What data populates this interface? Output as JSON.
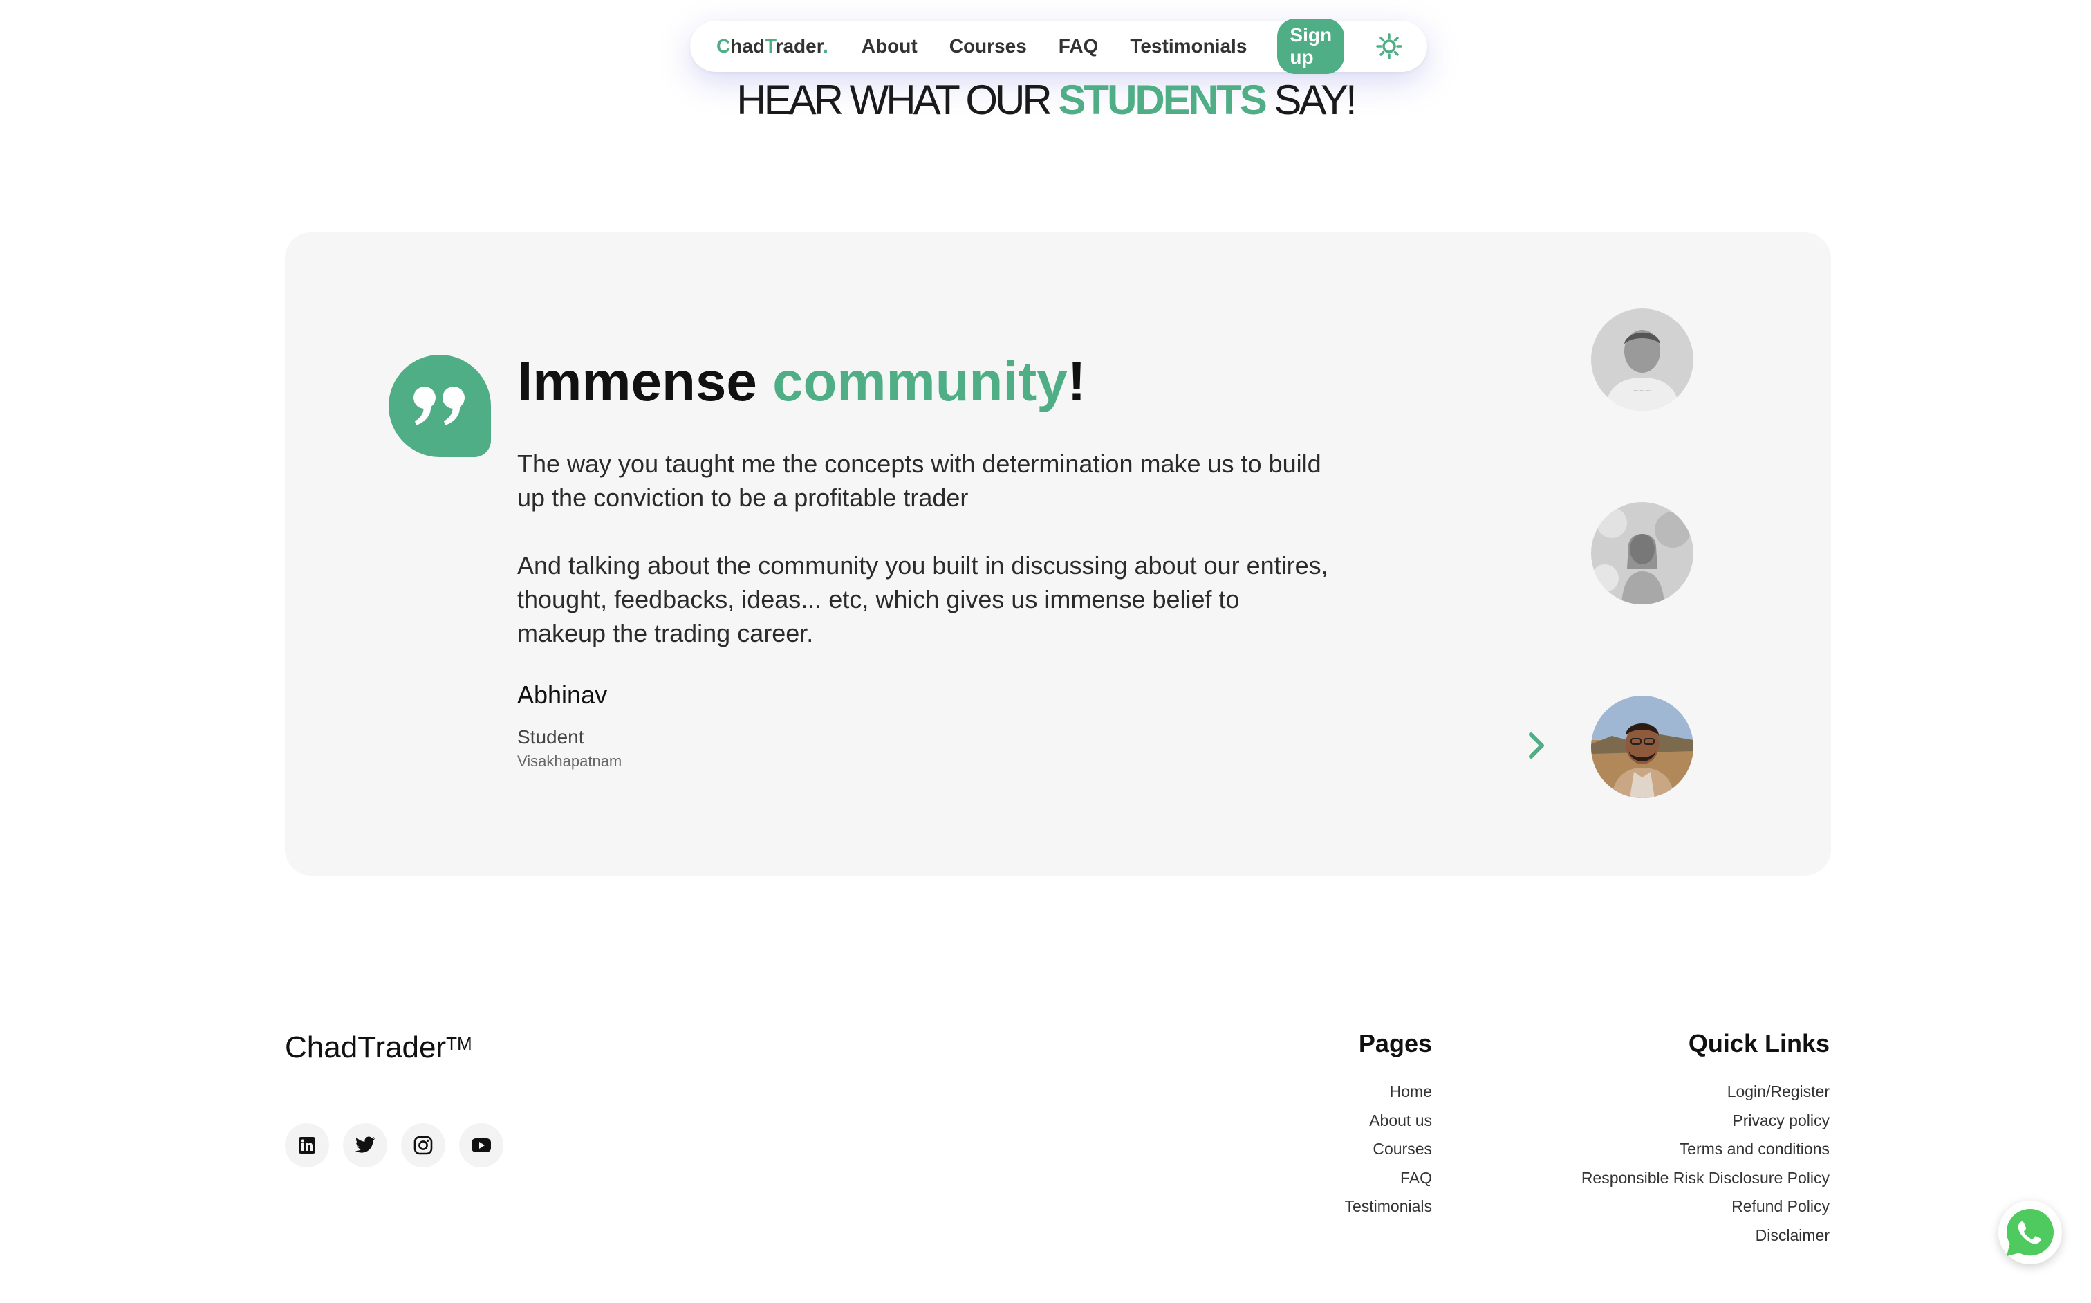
{
  "nav": {
    "logo": {
      "c": "C",
      "had": "had",
      "t": "T",
      "rader": "rader",
      "dot": "."
    },
    "links": [
      "About",
      "Courses",
      "FAQ",
      "Testimonials"
    ],
    "signup_label": "Sign up",
    "theme_icon": "sun-icon"
  },
  "heading": {
    "pre": "HEAR WHAT OUR ",
    "strong": "STUDENTS",
    "post": " SAY!"
  },
  "testimonial": {
    "title_pre": "Immense ",
    "title_accent": "community",
    "title_post": "!",
    "body1": "The way you taught me the concepts with determination make us to build up the conviction to be a profitable trader",
    "body2": "And talking about the community you built in discussing about our entires, thought, feedbacks, ideas... etc, which gives us immense belief to makeup the trading career.",
    "name": "Abhinav",
    "role": "Student",
    "city": "Visakhapatnam",
    "avatars": [
      "avatar-1",
      "avatar-2",
      "avatar-3-active"
    ]
  },
  "footer": {
    "brand": "ChadTrader",
    "tm": "TM",
    "socials": [
      "linkedin-icon",
      "twitter-icon",
      "instagram-icon",
      "youtube-icon"
    ],
    "pages": {
      "title": "Pages",
      "links": [
        "Home",
        "About us",
        "Courses",
        "FAQ",
        "Testimonials"
      ]
    },
    "quick": {
      "title": "Quick Links",
      "links": [
        "Login/Register",
        "Privacy policy",
        "Terms and conditions",
        "Responsible Risk Disclosure Policy",
        "Refund Policy",
        "Disclaimer"
      ]
    }
  },
  "colors": {
    "accent": "#4fae86",
    "card_bg": "#f6f6f6",
    "text": "#1a1a1a"
  }
}
